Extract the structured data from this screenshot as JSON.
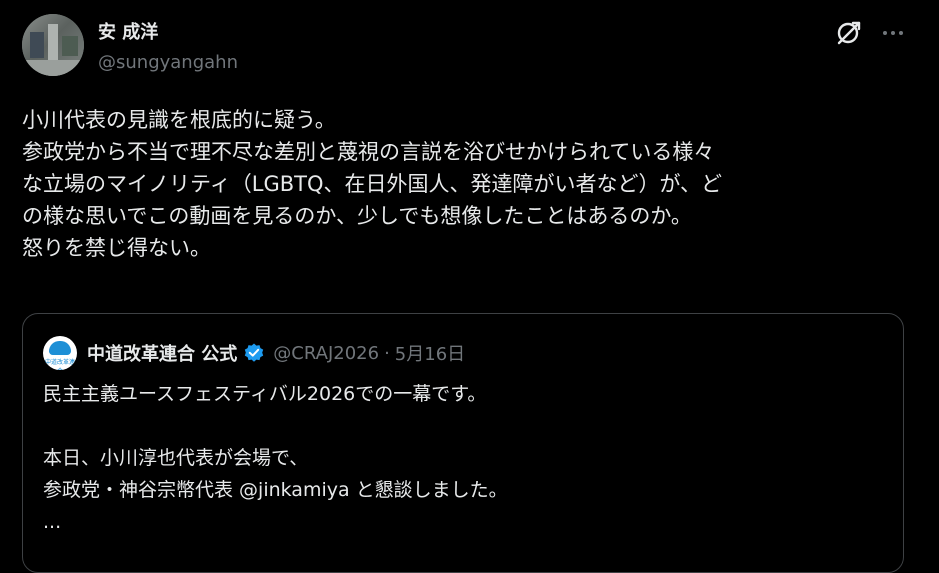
{
  "author": {
    "display_name": "安 成洋",
    "handle": "@sungyangahn"
  },
  "actions": {
    "grok_icon": "grok-icon",
    "more_icon": "more-icon"
  },
  "tweet": {
    "lines": [
      "小川代表の見識を根底的に疑う。",
      "参政党から不当で理不尽な差別と蔑視の言説を浴びせかけられている様々",
      "な立場のマイノリティ（LGBTQ、在日外国人、発達障がい者など）が、ど",
      "の様な思いでこの動画を見るのか、少しでも想像したことはあるのか。",
      "怒りを禁じ得ない。"
    ]
  },
  "quoted": {
    "display_name": "中道改革連合 公式",
    "handle": "@CRAJ2026",
    "separator": "·",
    "date": "5月16日",
    "logo_text": "中道改革連合",
    "lines": [
      "民主主義ユースフェスティバル2026での一幕です。",
      "",
      "本日、小川淳也代表が会場で、",
      "参政党・神谷宗幣代表 @jinkamiya と懇談しました。",
      "..."
    ]
  },
  "colors": {
    "background": "#000000",
    "text": "#e7e9ea",
    "muted": "#71767b",
    "border": "#3e4144",
    "verified": "#1d9bf0"
  }
}
